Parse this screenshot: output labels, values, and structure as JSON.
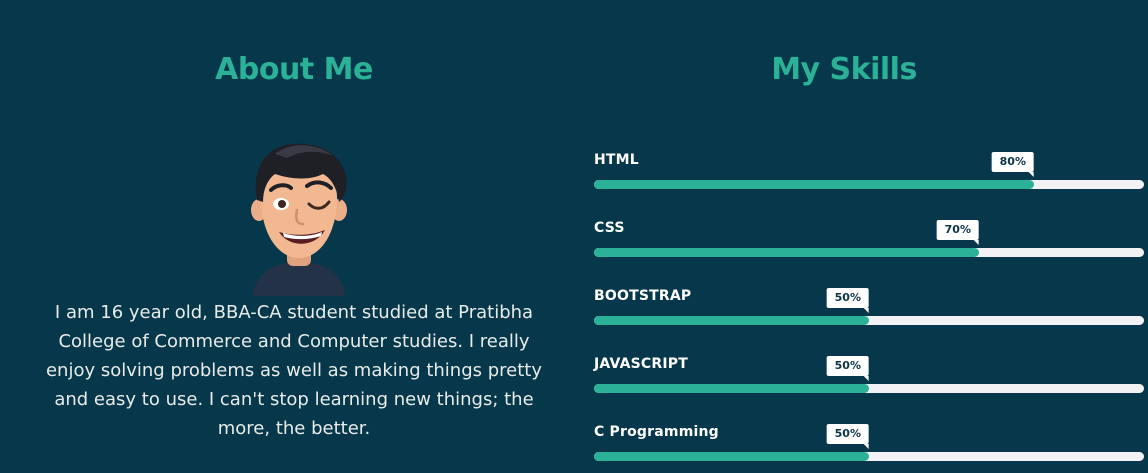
{
  "about": {
    "title": "About Me",
    "text": "I am 16 year old, BBA-CA student studied at Pratibha College of Commerce and Computer studies. I really enjoy solving problems as well as making things pretty and easy to use. I can't stop learning new things; the more, the better."
  },
  "skills": {
    "title": "My Skills",
    "items": [
      {
        "name": "HTML",
        "percent": 80,
        "label": "80%"
      },
      {
        "name": "CSS",
        "percent": 70,
        "label": "70%"
      },
      {
        "name": "BOOTSTRAP",
        "percent": 50,
        "label": "50%"
      },
      {
        "name": "JAVASCRIPT",
        "percent": 50,
        "label": "50%"
      },
      {
        "name": "C Programming",
        "percent": 50,
        "label": "50%"
      }
    ]
  },
  "colors": {
    "background": "#06374b",
    "accent": "#2ab197",
    "track": "#f2f2f4",
    "text": "#e8ece9"
  }
}
